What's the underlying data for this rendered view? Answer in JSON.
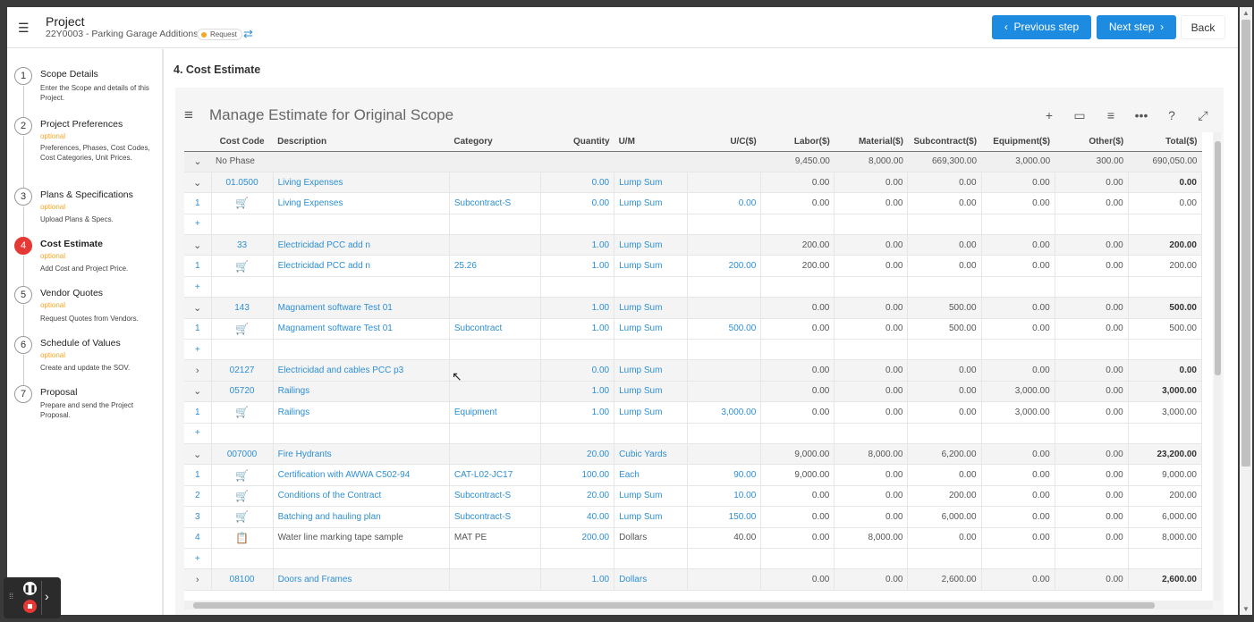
{
  "header": {
    "title": "Project",
    "subtitle": "22Y0003 - Parking Garage Additions",
    "badge": "Request",
    "prev_label": "Previous step",
    "next_label": "Next step",
    "back_label": "Back"
  },
  "steps": [
    {
      "num": "1",
      "title": "Scope Details",
      "optional": "",
      "desc": "Enter the Scope and details of this Project."
    },
    {
      "num": "2",
      "title": "Project Preferences",
      "optional": "optional",
      "desc": "Preferences, Phases, Cost Codes, Cost Categories, Unit Prices."
    },
    {
      "num": "3",
      "title": "Plans & Specifications",
      "optional": "optional",
      "desc": "Upload Plans & Specs."
    },
    {
      "num": "4",
      "title": "Cost Estimate",
      "optional": "optional",
      "desc": "Add Cost and Project Price."
    },
    {
      "num": "5",
      "title": "Vendor Quotes",
      "optional": "optional",
      "desc": "Request Quotes from Vendors."
    },
    {
      "num": "6",
      "title": "Schedule of Values",
      "optional": "optional",
      "desc": "Create and update the SOV."
    },
    {
      "num": "7",
      "title": "Proposal",
      "optional": "",
      "desc": "Prepare and send the Project Proposal."
    }
  ],
  "page_heading": "4. Cost Estimate",
  "grid_title": "Manage Estimate for Original Scope",
  "columns": {
    "cost_code": "Cost Code",
    "description": "Description",
    "category": "Category",
    "quantity": "Quantity",
    "um": "U/M",
    "uc": "U/C($)",
    "labor": "Labor($)",
    "material": "Material($)",
    "subcontract": "Subcontract($)",
    "equipment": "Equipment($)",
    "other": "Other($)",
    "total": "Total($)"
  },
  "phase": {
    "label": "No Phase",
    "labor": "9,450.00",
    "material": "8,000.00",
    "subcontract": "669,300.00",
    "equipment": "3,000.00",
    "other": "300.00",
    "total": "690,050.00"
  },
  "rows": [
    {
      "type": "group",
      "chev": "⌄",
      "code": "01.0500",
      "desc": "Living Expenses",
      "cat": "",
      "qty": "0.00",
      "um": "Lump Sum",
      "uc": "",
      "labor": "0.00",
      "material": "0.00",
      "sub": "0.00",
      "equip": "0.00",
      "other": "0.00",
      "total": "0.00"
    },
    {
      "type": "item",
      "line": "1",
      "icon": "cart",
      "desc": "Living Expenses",
      "cat": "Subcontract-S",
      "qty": "0.00",
      "um": "Lump Sum",
      "uc": "0.00",
      "labor": "0.00",
      "material": "0.00",
      "sub": "0.00",
      "equip": "0.00",
      "other": "0.00",
      "total": "0.00"
    },
    {
      "type": "add"
    },
    {
      "type": "group",
      "chev": "⌄",
      "code": "33",
      "desc": "Electricidad PCC add n",
      "cat": "",
      "qty": "1.00",
      "um": "Lump Sum",
      "uc": "",
      "labor": "200.00",
      "material": "0.00",
      "sub": "0.00",
      "equip": "0.00",
      "other": "0.00",
      "total": "200.00"
    },
    {
      "type": "item",
      "line": "1",
      "icon": "cart",
      "desc": "Electricidad PCC add n",
      "cat": "25.26",
      "qty": "1.00",
      "um": "Lump Sum",
      "uc": "200.00",
      "labor": "200.00",
      "material": "0.00",
      "sub": "0.00",
      "equip": "0.00",
      "other": "0.00",
      "total": "200.00"
    },
    {
      "type": "add"
    },
    {
      "type": "group",
      "chev": "⌄",
      "code": "143",
      "desc": "Magnament software Test 01",
      "cat": "",
      "qty": "1.00",
      "um": "Lump Sum",
      "uc": "",
      "labor": "0.00",
      "material": "0.00",
      "sub": "500.00",
      "equip": "0.00",
      "other": "0.00",
      "total": "500.00"
    },
    {
      "type": "item",
      "line": "1",
      "icon": "cart",
      "desc": "Magnament software Test 01",
      "cat": "Subcontract",
      "qty": "1.00",
      "um": "Lump Sum",
      "uc": "500.00",
      "labor": "0.00",
      "material": "0.00",
      "sub": "500.00",
      "equip": "0.00",
      "other": "0.00",
      "total": "500.00"
    },
    {
      "type": "add"
    },
    {
      "type": "group",
      "chev": "›",
      "code": "02127",
      "desc": "Electricidad and cables PCC p3",
      "cat": "",
      "qty": "0.00",
      "um": "Lump Sum",
      "uc": "",
      "labor": "0.00",
      "material": "0.00",
      "sub": "0.00",
      "equip": "0.00",
      "other": "0.00",
      "total": "0.00"
    },
    {
      "type": "group",
      "chev": "⌄",
      "code": "05720",
      "desc": "Railings",
      "cat": "",
      "qty": "1.00",
      "um": "Lump Sum",
      "uc": "",
      "labor": "0.00",
      "material": "0.00",
      "sub": "0.00",
      "equip": "3,000.00",
      "other": "0.00",
      "total": "3,000.00"
    },
    {
      "type": "item",
      "line": "1",
      "icon": "cart",
      "desc": "Railings",
      "cat": "Equipment",
      "qty": "1.00",
      "um": "Lump Sum",
      "uc": "3,000.00",
      "labor": "0.00",
      "material": "0.00",
      "sub": "0.00",
      "equip": "3,000.00",
      "other": "0.00",
      "total": "3,000.00"
    },
    {
      "type": "add"
    },
    {
      "type": "group",
      "chev": "⌄",
      "code": "007000",
      "desc": "Fire Hydrants",
      "cat": "",
      "qty": "20.00",
      "um": "Cubic Yards",
      "uc": "",
      "labor": "9,000.00",
      "material": "8,000.00",
      "sub": "6,200.00",
      "equip": "0.00",
      "other": "0.00",
      "total": "23,200.00"
    },
    {
      "type": "item",
      "line": "1",
      "icon": "cart",
      "desc": "Certification with AWWA C502-94",
      "cat": "CAT-L02-JC17",
      "qty": "100.00",
      "um": "Each",
      "uc": "90.00",
      "labor": "9,000.00",
      "material": "0.00",
      "sub": "0.00",
      "equip": "0.00",
      "other": "0.00",
      "total": "9,000.00"
    },
    {
      "type": "item",
      "line": "2",
      "icon": "cart",
      "desc": "Conditions of the Contract",
      "cat": "Subcontract-S",
      "qty": "20.00",
      "um": "Lump Sum",
      "uc": "10.00",
      "labor": "0.00",
      "material": "0.00",
      "sub": "200.00",
      "equip": "0.00",
      "other": "0.00",
      "total": "200.00"
    },
    {
      "type": "item",
      "line": "3",
      "icon": "cart",
      "desc": "Batching and hauling plan",
      "cat": "Subcontract-S",
      "qty": "40.00",
      "um": "Lump Sum",
      "uc": "150.00",
      "labor": "0.00",
      "material": "0.00",
      "sub": "6,000.00",
      "equip": "0.00",
      "other": "0.00",
      "total": "6,000.00"
    },
    {
      "type": "item",
      "line": "4",
      "icon": "doc",
      "plain": true,
      "desc": "Water line marking tape sample",
      "cat": "MAT PE",
      "qty": "200.00",
      "um": "Dollars",
      "uc": "40.00",
      "labor": "0.00",
      "material": "8,000.00",
      "sub": "0.00",
      "equip": "0.00",
      "other": "0.00",
      "total": "8,000.00"
    },
    {
      "type": "add"
    },
    {
      "type": "group",
      "chev": "›",
      "code": "08100",
      "desc": "Doors and Frames",
      "cat": "",
      "qty": "1.00",
      "um": "Dollars",
      "uc": "",
      "labor": "0.00",
      "material": "0.00",
      "sub": "2,600.00",
      "equip": "0.00",
      "other": "0.00",
      "total": "2,600.00"
    }
  ],
  "colors": {
    "accent": "#1d8be0",
    "link": "#2d8fd5",
    "active_step": "#e53935",
    "optional": "#f5a623"
  }
}
